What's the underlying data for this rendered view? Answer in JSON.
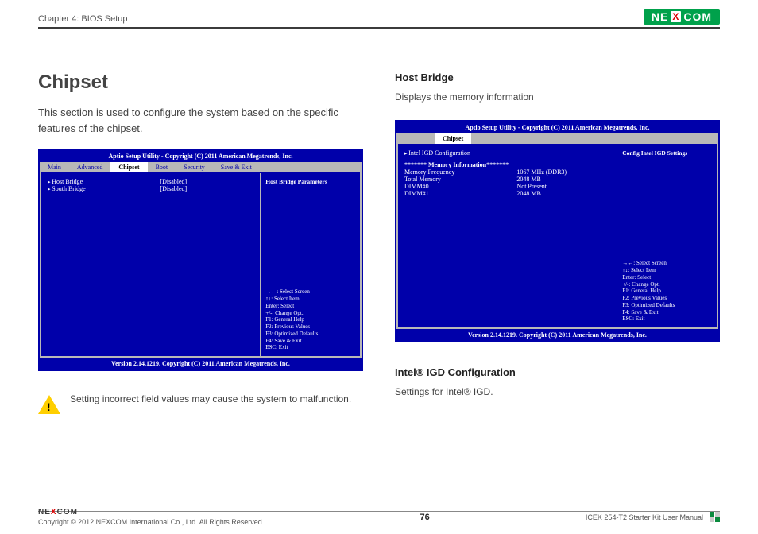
{
  "header": {
    "chapter": "Chapter 4: BIOS Setup",
    "brand_left": "NE",
    "brand_x": "X",
    "brand_right": "COM"
  },
  "left": {
    "title": "Chipset",
    "intro": "This section is used to configure the system based on the specific features of the chipset.",
    "bios": {
      "top_bar": "Aptio Setup Utility - Copyright (C) 2011 American Megatrends, Inc.",
      "tabs": [
        "Main",
        "Advanced",
        "Chipset",
        "Boot",
        "Security",
        "Save & Exit"
      ],
      "active_tab": "Chipset",
      "rows": [
        {
          "label": "Host Bridge",
          "value": "[Disabled]"
        },
        {
          "label": "South Bridge",
          "value": "[Disabled]"
        }
      ],
      "help_title": "Host Bridge Parameters",
      "keys": [
        "→←: Select Screen",
        "↑↓: Select Item",
        "Enter: Select",
        "+/-: Change Opt.",
        "F1: General Help",
        "F2: Previous Values",
        "F3: Optimized Defaults",
        "F4: Save & Exit",
        "ESC: Exit"
      ],
      "bottom_bar": "Version 2.14.1219. Copyright (C) 2011 American Megatrends, Inc."
    },
    "warning": "Setting incorrect field values may cause the system to malfunction."
  },
  "right": {
    "h1": "Host Bridge",
    "d1": "Displays the memory information",
    "bios": {
      "top_bar": "Aptio Setup Utility - Copyright (C) 2011 American Megatrends, Inc.",
      "active_tab": "Chipset",
      "link": "Intel IGD Configuration",
      "info_head": "******* Memory Information*******",
      "rows": [
        {
          "label": "Memory Frequency",
          "value": "1067 MHz (DDR3)"
        },
        {
          "label": "Total Memory",
          "value": "2048 MB"
        },
        {
          "label": "DIMM#0",
          "value": "Not Present"
        },
        {
          "label": "DIMM#1",
          "value": "2048 MB"
        }
      ],
      "help_title": "Config Intel IGD Settings",
      "keys": [
        "→←: Select Screen",
        "↑↓: Select Item",
        "Enter: Select",
        "+/-: Change Opt.",
        "F1: General Help",
        "F2: Previous Values",
        "F3: Optimized Defaults",
        "F4: Save & Exit",
        "ESC: Exit"
      ],
      "bottom_bar": "Version 2.14.1219. Copyright (C) 2011 American Megatrends, Inc."
    },
    "h2": "Intel® IGD Configuration",
    "d2": "Settings for Intel® IGD."
  },
  "footer": {
    "copyright": "Copyright © 2012 NEXCOM International Co., Ltd. All Rights Reserved.",
    "page": "76",
    "manual": "ICEK 254-T2 Starter Kit User Manual"
  }
}
